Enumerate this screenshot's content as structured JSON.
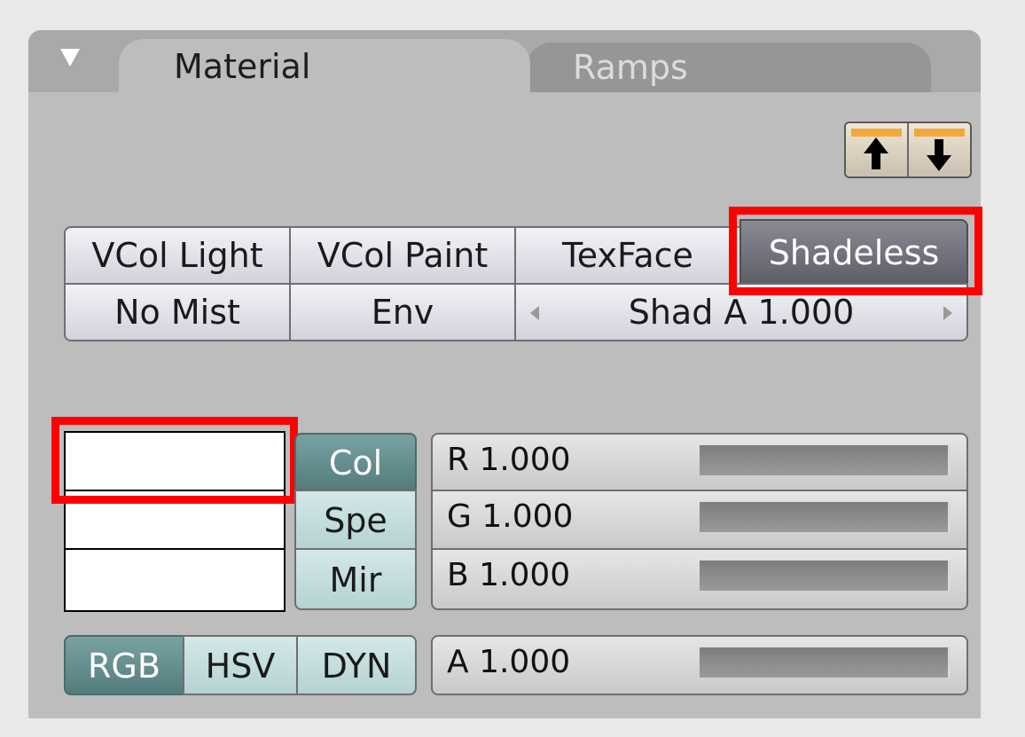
{
  "tabs": [
    {
      "label": "Material",
      "active": true
    },
    {
      "label": "Ramps",
      "active": false
    }
  ],
  "header": {
    "collapse_icon": "triangle-down-icon",
    "updown_icons": [
      "move-up-icon",
      "move-down-icon"
    ]
  },
  "toggles": {
    "vcol_light": "VCol Light",
    "vcol_paint": "VCol Paint",
    "texface": "TexFace",
    "shadeless": "Shadeless",
    "no_mist": "No Mist",
    "env": "Env"
  },
  "shad_a": {
    "label": "Shad A 1.000"
  },
  "color_modes": {
    "col": "Col",
    "spe": "Spe",
    "mir": "Mir"
  },
  "channels": {
    "r": {
      "label": "R 1.000",
      "value": 1.0
    },
    "g": {
      "label": "G 1.000",
      "value": 1.0
    },
    "b": {
      "label": "B 1.000",
      "value": 1.0
    },
    "a": {
      "label": "A 1.000",
      "value": 1.0
    }
  },
  "color_spaces": {
    "rgb": "RGB",
    "hsv": "HSV",
    "dyn": "DYN"
  },
  "colors": {
    "highlight": "#ff0000",
    "swatch": "#ffffff",
    "accent": "#f2a93b"
  }
}
